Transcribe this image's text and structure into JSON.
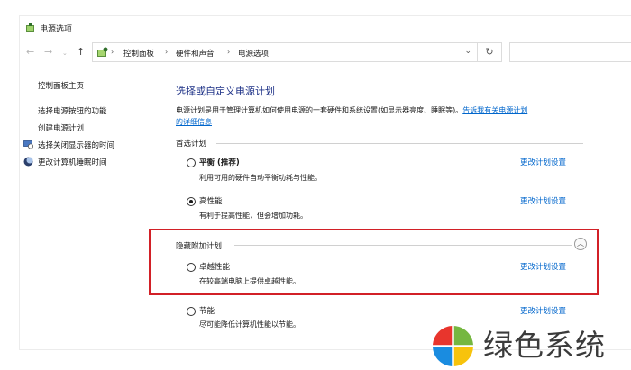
{
  "window": {
    "title": "电源选项"
  },
  "address_bar": {
    "breadcrumbs": [
      "控制面板",
      "硬件和声音",
      "电源选项"
    ],
    "refresh_icon": "refresh-icon"
  },
  "sidebar": {
    "home_label": "控制面板主页",
    "links": [
      "选择电源按钮的功能",
      "创建电源计划",
      "选择关闭显示器的时间",
      "更改计算机睡眠时间"
    ]
  },
  "main": {
    "title": "选择或自定义电源计划",
    "description": "电源计划是用于管理计算机如何使用电源的一套硬件和系统设置(如显示器亮度、睡眠等)。",
    "help_link_part1": "告诉我有关电源计划",
    "help_link_part2": "的详细信息",
    "preferred_group_label": "首选计划",
    "hidden_group_label": "隐藏附加计划",
    "change_settings_label": "更改计划设置",
    "plans": [
      {
        "name": "平衡 (推荐)",
        "desc": "利用可用的硬件自动平衡功耗与性能。",
        "selected": false
      },
      {
        "name": "高性能",
        "desc": "有利于提高性能，但会增加功耗。",
        "selected": true
      },
      {
        "name": "卓越性能",
        "desc": "在较高端电脑上提供卓越性能。",
        "selected": false
      },
      {
        "name": "节能",
        "desc": "尽可能降低计算机性能以节能。",
        "selected": false
      }
    ]
  },
  "watermark": {
    "text": "绿色系统"
  },
  "colors": {
    "title_blue": "#1e3287",
    "link_blue": "#0066cc",
    "highlight_red": "#d22027"
  }
}
